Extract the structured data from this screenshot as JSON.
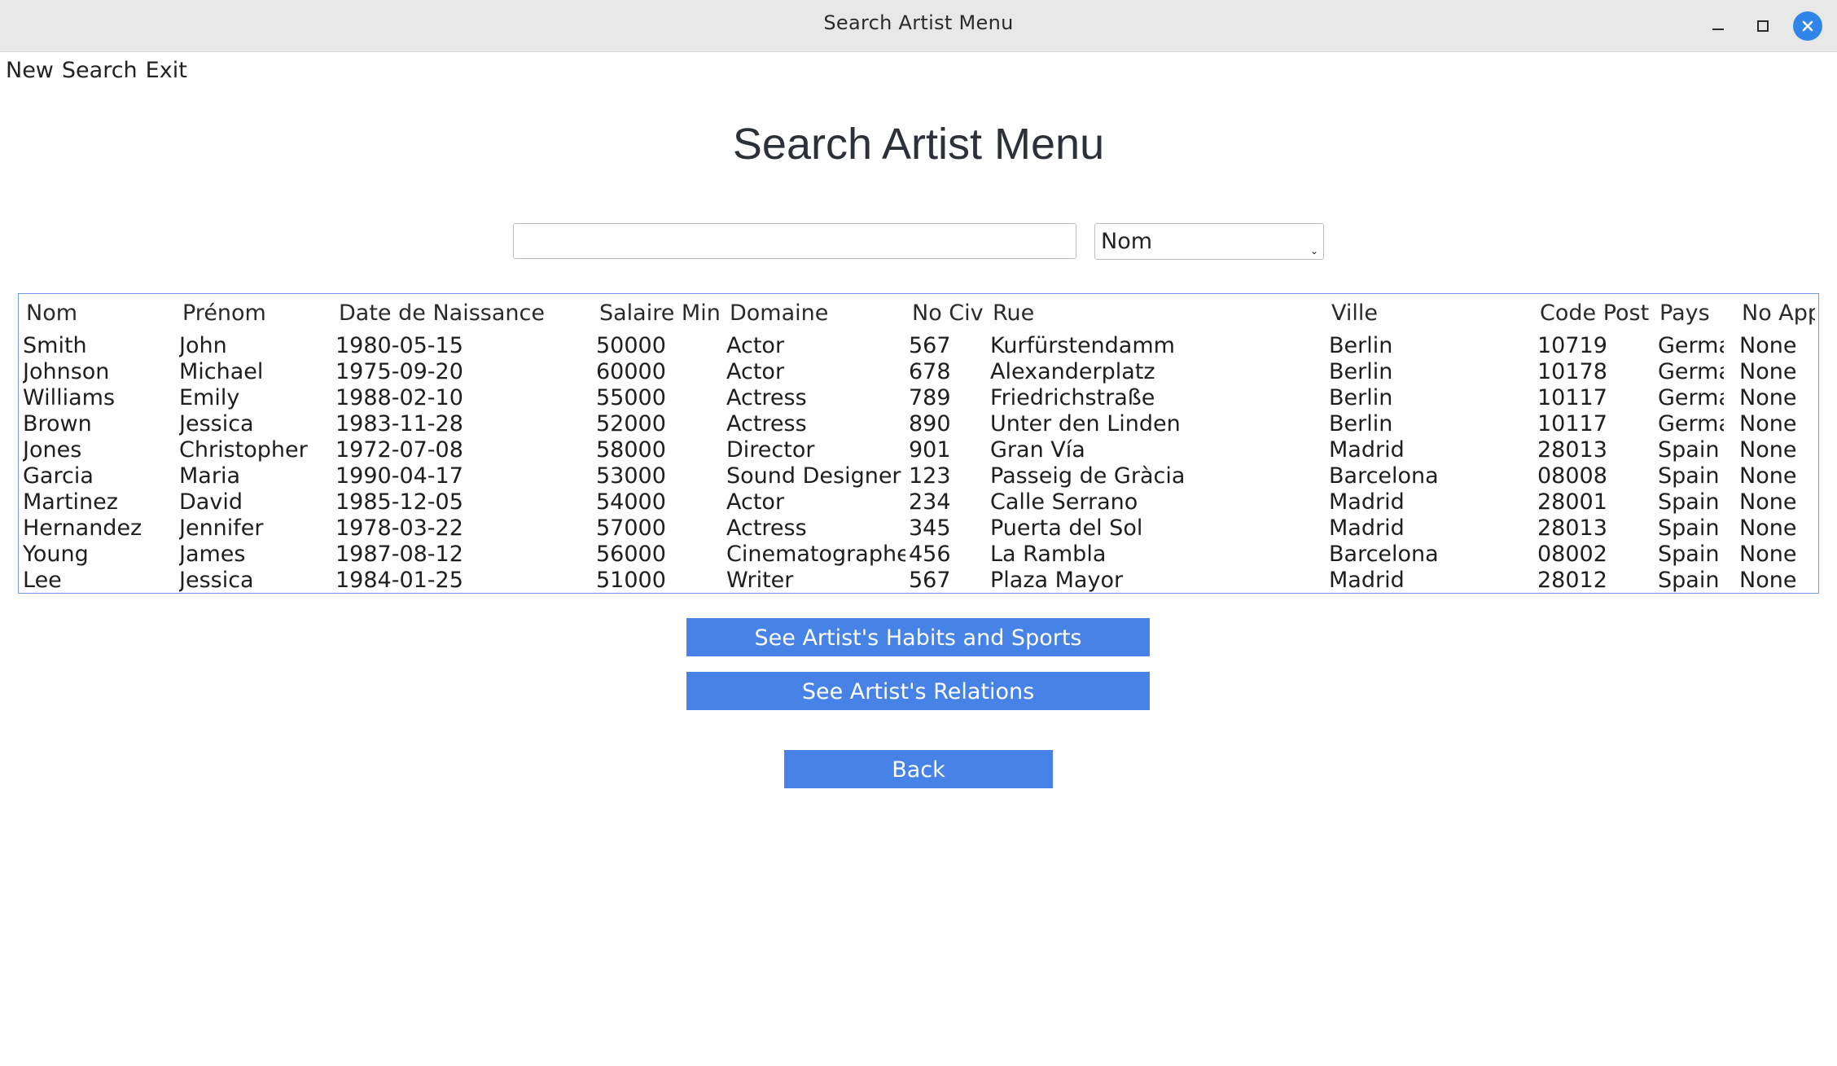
{
  "window": {
    "title": "Search Artist Menu"
  },
  "menubar": {
    "items": [
      "New",
      "Search",
      "Exit"
    ]
  },
  "page": {
    "title": "Search Artist Menu"
  },
  "search": {
    "value": "",
    "field_selected": "Nom"
  },
  "table": {
    "columns": [
      "Nom",
      "Prénom",
      "Date de Naissance",
      "Salaire Min",
      "Domaine",
      "No Civ",
      "Rue",
      "Ville",
      "Code Post",
      "Pays",
      "No App"
    ],
    "rows": [
      [
        "Smith",
        "John",
        "1980-05-15",
        "50000",
        "Actor",
        "567",
        "Kurfürstendamm",
        "Berlin",
        "10719",
        "Germany",
        "None"
      ],
      [
        "Johnson",
        "Michael",
        "1975-09-20",
        "60000",
        "Actor",
        "678",
        "Alexanderplatz",
        "Berlin",
        "10178",
        "Germany",
        "None"
      ],
      [
        "Williams",
        "Emily",
        "1988-02-10",
        "55000",
        "Actress",
        "789",
        "Friedrichstraße",
        "Berlin",
        "10117",
        "Germany",
        "None"
      ],
      [
        "Brown",
        "Jessica",
        "1983-11-28",
        "52000",
        "Actress",
        "890",
        "Unter den Linden",
        "Berlin",
        "10117",
        "Germany",
        "None"
      ],
      [
        "Jones",
        "Christopher",
        "1972-07-08",
        "58000",
        "Director",
        "901",
        "Gran Vía",
        "Madrid",
        "28013",
        "Spain",
        "None"
      ],
      [
        "Garcia",
        "Maria",
        "1990-04-17",
        "53000",
        "Sound Designer",
        "123",
        "Passeig de Gràcia",
        "Barcelona",
        "08008",
        "Spain",
        "None"
      ],
      [
        "Martinez",
        "David",
        "1985-12-05",
        "54000",
        "Actor",
        "234",
        "Calle Serrano",
        "Madrid",
        "28001",
        "Spain",
        "None"
      ],
      [
        "Hernandez",
        "Jennifer",
        "1978-03-22",
        "57000",
        "Actress",
        "345",
        "Puerta del Sol",
        "Madrid",
        "28013",
        "Spain",
        "None"
      ],
      [
        "Young",
        "James",
        "1987-08-12",
        "56000",
        "Cinematographer",
        "456",
        "La Rambla",
        "Barcelona",
        "08002",
        "Spain",
        "None"
      ],
      [
        "Lee",
        "Jessica",
        "1984-01-25",
        "51000",
        "Writer",
        "567",
        "Plaza Mayor",
        "Madrid",
        "28012",
        "Spain",
        "None"
      ]
    ]
  },
  "buttons": {
    "habits": "See Artist's Habits and Sports",
    "relations": "See Artist's Relations",
    "back": "Back"
  },
  "colors": {
    "button_bg": "#4783e6",
    "close_button": "#2f86e8",
    "table_border": "#6f9be2"
  },
  "icons": {
    "minimize": "minimize-icon",
    "maximize": "maximize-icon",
    "close": "close-icon",
    "dropdown": "chevron-down-icon"
  }
}
